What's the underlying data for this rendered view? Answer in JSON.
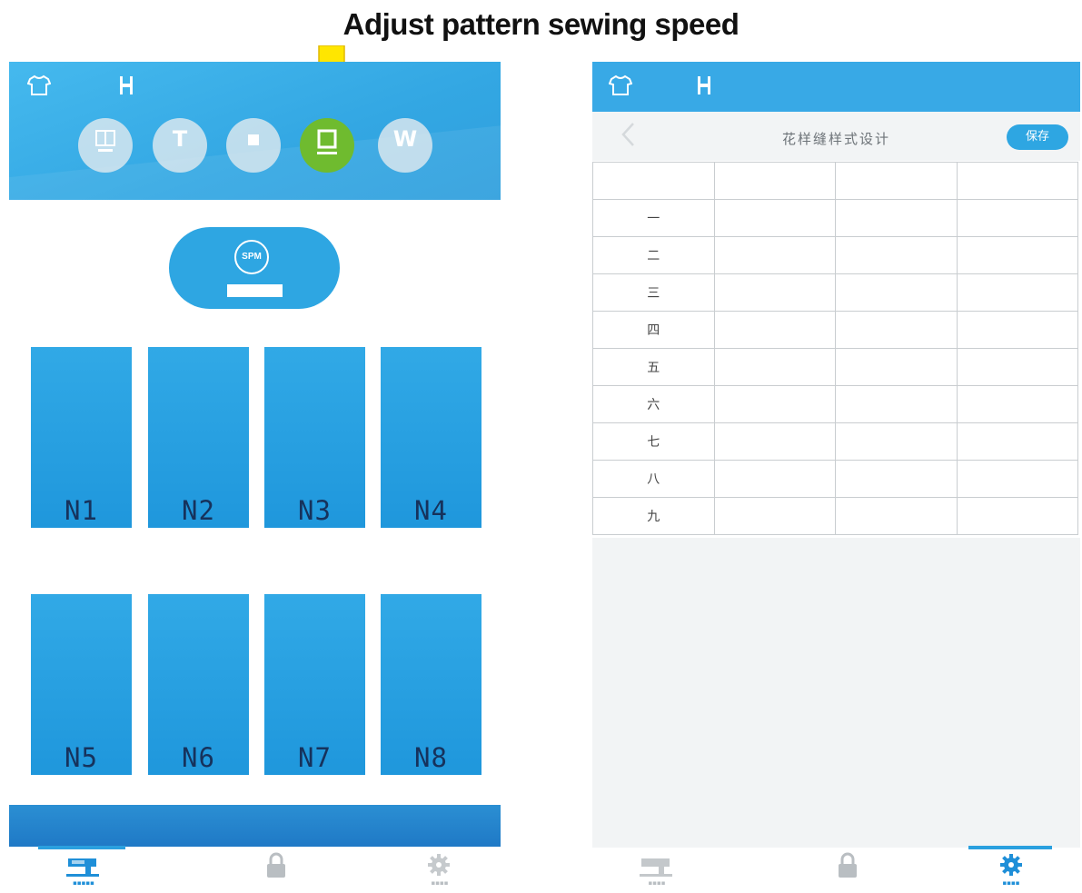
{
  "caption": "Adjust pattern sewing speed",
  "left_panel": {
    "header_icons": [
      "shirt-icon",
      "presser-foot-icon"
    ],
    "mode_buttons": [
      {
        "name": "mode-button-1",
        "glyph": "",
        "active": false
      },
      {
        "name": "mode-button-2",
        "glyph": "T",
        "active": false
      },
      {
        "name": "mode-button-3",
        "glyph": "",
        "active": false
      },
      {
        "name": "mode-button-4",
        "glyph": "",
        "active": true
      },
      {
        "name": "mode-button-5",
        "glyph": "W",
        "active": false
      }
    ],
    "spm_label": "SPM",
    "presets_row1": [
      "N1",
      "N2",
      "N3",
      "N4"
    ],
    "presets_row2": [
      "N5",
      "N6",
      "N7",
      "N8"
    ]
  },
  "right_panel": {
    "page_title": "花样缝样式设计",
    "save_label": "保存",
    "columns": [
      "",
      "",
      "",
      ""
    ],
    "rows": [
      "一",
      "二",
      "三",
      "四",
      "五",
      "六",
      "七",
      "八",
      "九"
    ]
  },
  "tabs_left": [
    {
      "icon": "sewing-machine-icon",
      "active": true
    },
    {
      "icon": "lock-icon",
      "active": false
    },
    {
      "icon": "gear-icon",
      "active": false
    }
  ],
  "tabs_right": [
    {
      "icon": "sewing-machine-icon",
      "active": false
    },
    {
      "icon": "lock-icon",
      "active": false
    },
    {
      "icon": "gear-icon",
      "active": true
    }
  ],
  "colors": {
    "primary_blue": "#2ea6e2",
    "active_green": "#6fbb2f",
    "arrow_yellow": "#ffe600",
    "preset_label": "#16325c"
  }
}
